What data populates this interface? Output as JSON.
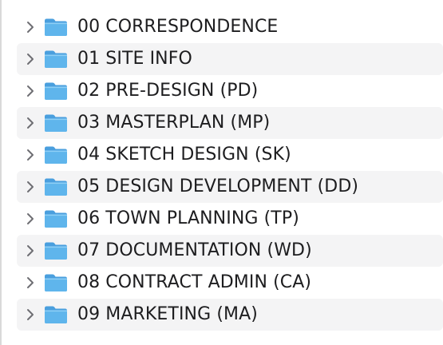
{
  "folders": [
    {
      "name": "00 CORRESPONDENCE",
      "icon": "folder-icon",
      "expanded": false
    },
    {
      "name": "01 SITE INFO",
      "icon": "folder-icon",
      "expanded": false
    },
    {
      "name": "02 PRE-DESIGN (PD)",
      "icon": "folder-icon",
      "expanded": false
    },
    {
      "name": "03 MASTERPLAN (MP)",
      "icon": "folder-icon",
      "expanded": false
    },
    {
      "name": "04 SKETCH DESIGN (SK)",
      "icon": "folder-icon",
      "expanded": false
    },
    {
      "name": "05 DESIGN DEVELOPMENT (DD)",
      "icon": "folder-icon",
      "expanded": false
    },
    {
      "name": "06 TOWN PLANNING (TP)",
      "icon": "folder-icon",
      "expanded": false
    },
    {
      "name": "07 DOCUMENTATION (WD)",
      "icon": "folder-icon",
      "expanded": false
    },
    {
      "name": "08 CONTRACT ADMIN (CA)",
      "icon": "folder-icon",
      "expanded": false
    },
    {
      "name": "09 MARKETING (MA)",
      "icon": "folder-icon",
      "expanded": false
    }
  ],
  "colors": {
    "folder_body": "#5fb5ec",
    "folder_tab": "#4a9fde",
    "folder_top": "#8ecff6",
    "chevron": "#6e6e73",
    "alt_row": "#f4f4f5",
    "text": "#1d1d1f"
  }
}
